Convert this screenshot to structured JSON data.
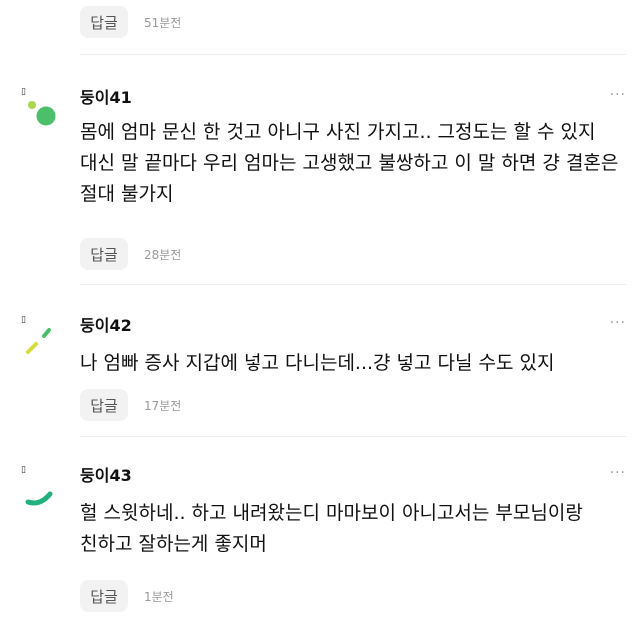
{
  "top": {
    "reply_label": "답글",
    "time": "51분전"
  },
  "comments": [
    {
      "nickname": "둥이41",
      "text": "몸에 엄마 문신 한 것고 아니구 사진 가지고.. 그정도는 할 수 있지 대신 말 끝마다 우리 엄마는 고생했고 불쌍하고 이 말 하면 걍 결혼은 절대 불가지",
      "reply_label": "답글",
      "time": "28분전",
      "more": "···"
    },
    {
      "nickname": "둥이42",
      "text": "나 엄빠 증사 지갑에 넣고 다니는데...걍 넣고 다닐 수도 있지",
      "reply_label": "답글",
      "time": "17분전",
      "more": "···"
    },
    {
      "nickname": "둥이43",
      "text": "헐 스윗하네.. 하고 내려왔는디 마마보이 아니고서는 부모님이랑 친하고 잘하는게 좋지머",
      "reply_label": "답글",
      "time": "1분전",
      "more": "···"
    }
  ],
  "colors": {
    "avatar_green": "#4cbf6b",
    "avatar_lime": "#a8d84e",
    "avatar_yellow": "#d6dc3c",
    "avatar_teal": "#22b07d"
  },
  "icons": {
    "more": "more-dots-icon"
  }
}
